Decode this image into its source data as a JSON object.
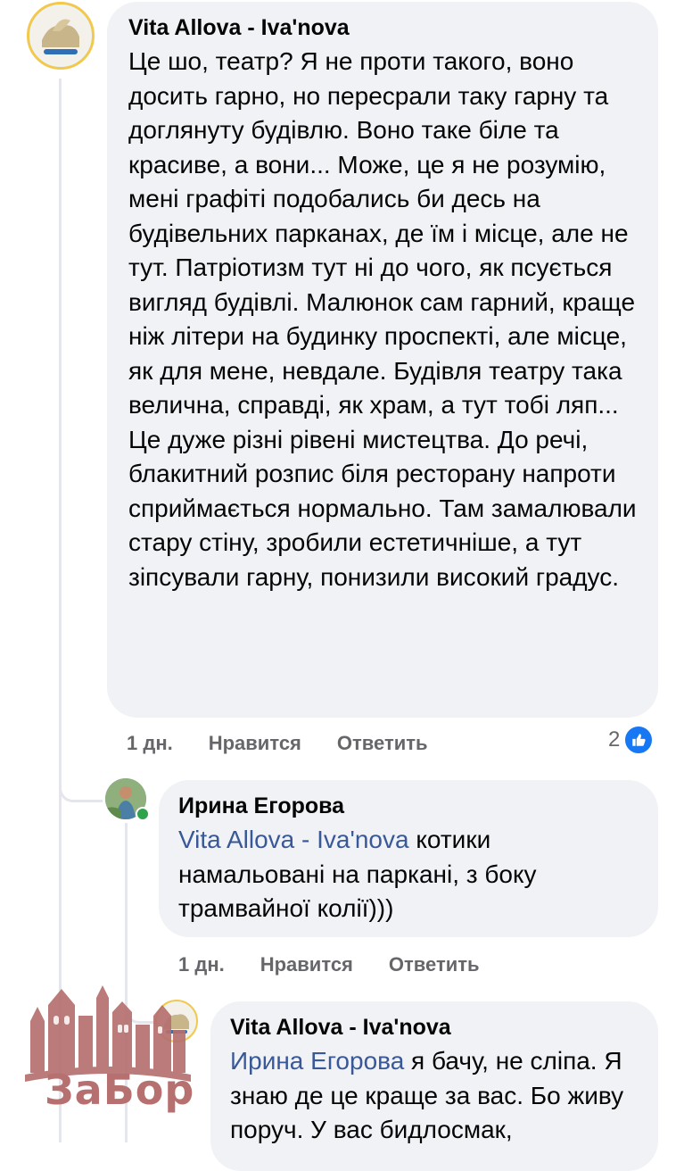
{
  "comment1": {
    "author": "Vita Allova - Iva'nova",
    "text": "Це шо, театр? Я не проти такого, воно досить гарно, но пересрали таку гарну та доглянуту будівлю. Воно таке біле та красиве, а вони... Може, це я не розумію, мені графіті подобались би десь на будівельних парканах, де їм і місце, але не тут. Патріотизм тут ні до чого, як псується вигляд будівлі. Малюнок сам гарний, краще ніж літери на будинку проспекті, але місце, як для мене, невдале. Будівля театру така велична, справді, як храм, а тут тобі ляп... Це дуже різні рівені мистецтва. До речі, блакитний розпис біля ресторану напроти сприймається нормально. Там замалювали стару стіну, зробили естетичніше, а тут зіпсували гарну, понизили високий градус.",
    "time": "1 дн.",
    "like_label": "Нравится",
    "reply_label": "Ответить",
    "reaction_count": "2",
    "like_color": "#1877f2"
  },
  "reply1": {
    "author": "Ирина Егорова",
    "mention": "Vita Allova - Iva'nova",
    "text": " котики намальовані на паркані, з боку трамвайної колії)))",
    "time": "1 дн.",
    "like_label": "Нравится",
    "reply_label": "Ответить"
  },
  "reply2": {
    "author": "Vita Allova - Iva'nova",
    "mention": "Ирина Егорова",
    "text": " я бачу, не сліпа. Я знаю де це краще за вас. Бо живу поруч. У вас бидлосмак,"
  },
  "watermark": {
    "text": "ЗаБор",
    "color": "#b5706f"
  }
}
